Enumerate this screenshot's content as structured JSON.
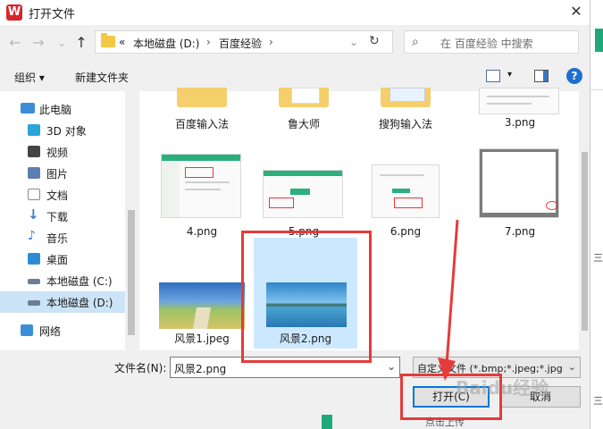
{
  "window": {
    "title": "打开文件",
    "close_glyph": "✕"
  },
  "nav_buttons": {
    "back": "←",
    "forward": "→",
    "recent": "⌄",
    "up": "↑"
  },
  "address": {
    "prefix": "«",
    "drive": "本地磁盘 (D:)",
    "sep1": "›",
    "folder": "百度经验",
    "sep2": "›",
    "refresh": "↻"
  },
  "search": {
    "icon": "⌕",
    "placeholder": "在 百度经验 中搜索"
  },
  "toolbar": {
    "organize": "组织 ▾",
    "new_folder": "新建文件夹",
    "view_dd": "▾",
    "help": "?"
  },
  "sidebar": {
    "items": [
      {
        "label": "此电脑",
        "icon": "computer-icon",
        "color": "#3b8ed6"
      },
      {
        "label": "3D 对象",
        "icon": "cube-icon",
        "color": "#2aa5d8"
      },
      {
        "label": "视频",
        "icon": "video-icon",
        "color": "#444444"
      },
      {
        "label": "图片",
        "icon": "picture-icon",
        "color": "#5d7fb0"
      },
      {
        "label": "文档",
        "icon": "document-icon",
        "color": "#8a8a8a"
      },
      {
        "label": "下载",
        "icon": "download-icon",
        "color": "#2f7fd6"
      },
      {
        "label": "音乐",
        "icon": "music-icon",
        "color": "#2f7fd6"
      },
      {
        "label": "桌面",
        "icon": "desktop-icon",
        "color": "#2f8ad6"
      },
      {
        "label": "本地磁盘 (C:)",
        "icon": "drive-icon",
        "color": "#6e7f92"
      },
      {
        "label": "本地磁盘 (D:)",
        "icon": "drive-icon",
        "color": "#6e7f92"
      },
      {
        "label": "网络",
        "icon": "network-icon",
        "color": "#3b8ed6"
      }
    ]
  },
  "files": [
    {
      "name": "百度输入法",
      "kind": "folder"
    },
    {
      "name": "鲁大师",
      "kind": "folder"
    },
    {
      "name": "搜狗输入法",
      "kind": "folder"
    },
    {
      "name": "3.png",
      "kind": "screenshot"
    },
    {
      "name": "4.png",
      "kind": "screenshot"
    },
    {
      "name": "5.png",
      "kind": "screenshot"
    },
    {
      "name": "6.png",
      "kind": "screenshot"
    },
    {
      "name": "7.png",
      "kind": "screenshot"
    },
    {
      "name": "风景1.jpeg",
      "kind": "landscape"
    },
    {
      "name": "风景2.png",
      "kind": "landscape",
      "selected": true
    }
  ],
  "footer": {
    "filename_label": "文件名(N):",
    "filename_value": "风景2.png",
    "filetype": "自定义文件 (*.bmp;*.jpeg;*.jpg",
    "open_button": "打开(C)",
    "cancel_button": "取消"
  },
  "background_app": {
    "bottom_text": "点击上传",
    "side_text_1": "三",
    "side_text_2": "三"
  },
  "watermark": "Baidu经验",
  "colors": {
    "accent": "#0078d7",
    "selection": "#cce8ff",
    "annotation": "#e53b3b",
    "brand_green": "#1fa97a"
  }
}
